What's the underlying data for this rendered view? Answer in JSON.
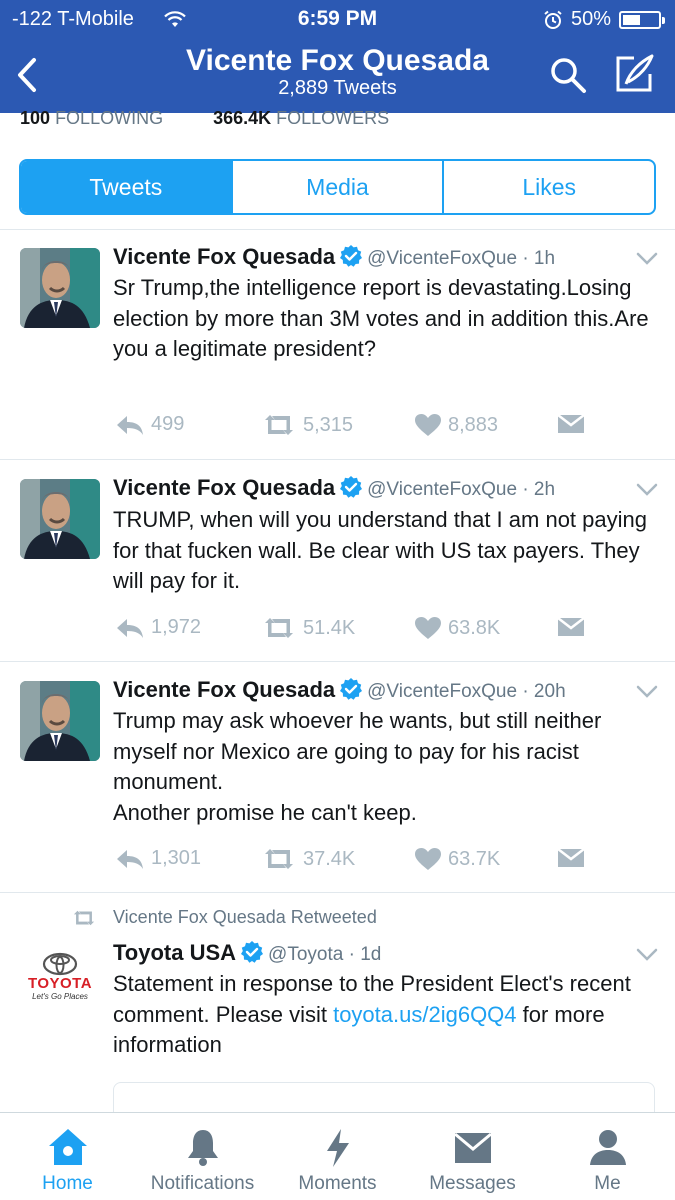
{
  "status_bar": {
    "carrier": "-122 T-Mobile",
    "time": "6:59 PM",
    "battery": "50%",
    "battery_level": 0.5
  },
  "nav": {
    "title": "Vicente Fox Quesada",
    "subtitle": "2,889 Tweets"
  },
  "counts": {
    "following_count": "100",
    "following_label": "FOLLOWING",
    "followers_count": "366.4K",
    "followers_label": "FOLLOWERS"
  },
  "tabs": [
    {
      "label": "Tweets",
      "active": true
    },
    {
      "label": "Media",
      "active": false
    },
    {
      "label": "Likes",
      "active": false
    }
  ],
  "tweets": [
    {
      "name": "Vicente Fox Quesada",
      "handle": "@VicenteFoxQue · 1h",
      "text": "Sr Trump,the intelligence report is devastating.Losing election by more than 3M votes and in addition this.Are you a legitimate president?",
      "replies": "499",
      "retweets": "5,315",
      "likes": "8,883"
    },
    {
      "name": "Vicente Fox Quesada",
      "handle": "@VicenteFoxQue · 2h",
      "text": "TRUMP,  when will you understand that I am not paying for that fucken wall. Be clear with US tax payers. They will pay for it.",
      "replies": "1,972",
      "retweets": "51.4K",
      "likes": "63.8K"
    },
    {
      "name": "Vicente Fox Quesada",
      "handle": "@VicenteFoxQue · 20h",
      "text_line1": "Trump may ask whoever he wants, but still neither myself nor Mexico are going to pay for his racist monument.",
      "text_line2": "Another promise he can't keep.",
      "replies": "1,301",
      "retweets": "37.4K",
      "likes": "63.7K"
    }
  ],
  "retweet": {
    "context": "Vicente Fox Quesada Retweeted",
    "name": "Toyota USA",
    "handle": "@Toyota · 1d",
    "text_before": "Statement in response to the President Elect's recent comment. Please visit ",
    "link": "toyota.us/2ig6QQ4",
    "text_after": " for more information",
    "logo_text": "TOYOTA",
    "logo_tagline": "Let's Go Places"
  },
  "tabbar": [
    {
      "label": "Home",
      "icon": "home-icon",
      "active": true
    },
    {
      "label": "Notifications",
      "icon": "bell-icon",
      "active": false
    },
    {
      "label": "Moments",
      "icon": "lightning-icon",
      "active": false
    },
    {
      "label": "Messages",
      "icon": "envelope-icon",
      "active": false
    },
    {
      "label": "Me",
      "icon": "person-icon",
      "active": false
    }
  ],
  "colors": {
    "header": "#2c59b3",
    "accent": "#1da1f2",
    "muted": "#657786",
    "toyota_red": "#d71f26"
  }
}
